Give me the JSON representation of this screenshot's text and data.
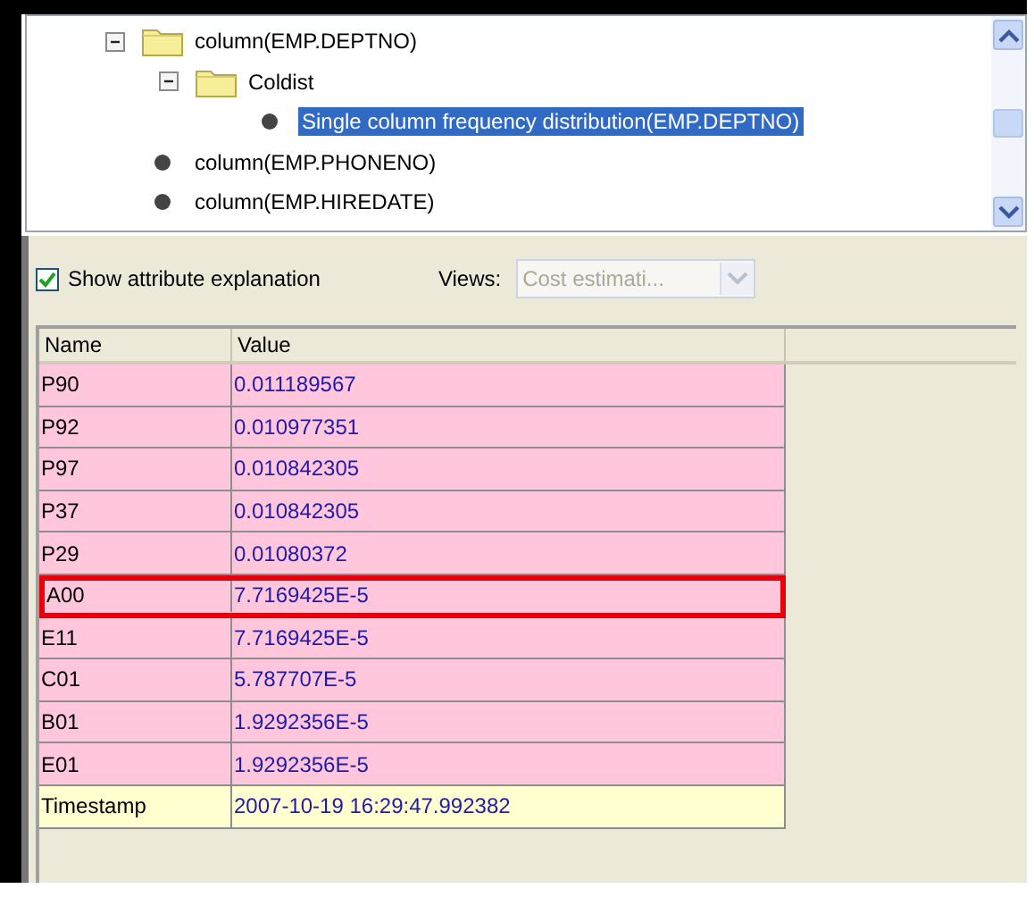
{
  "tree": [
    {
      "label": "column(EMP.DEPTNO)",
      "kind": "folder",
      "expanded": true,
      "selected": false,
      "children": [
        {
          "label": "Coldist",
          "kind": "folder",
          "expanded": true,
          "selected": false,
          "children": [
            {
              "label": "Single column frequency distribution(EMP.DEPTNO)",
              "kind": "leaf",
              "selected": true
            }
          ]
        }
      ]
    },
    {
      "label": "column(EMP.PHONENO)",
      "kind": "leaf",
      "selected": false
    },
    {
      "label": "column(EMP.HIREDATE)",
      "kind": "leaf",
      "selected": false
    }
  ],
  "options": {
    "checkbox": {
      "label": "Show attribute explanation",
      "checked": true
    },
    "views": {
      "label": "Views:",
      "value": "Cost estimati...",
      "disabled": true
    }
  },
  "table": {
    "columns": [
      "Name",
      "Value"
    ],
    "rows": [
      {
        "name": "P90",
        "value": "0.011189567",
        "kind": "attribute",
        "highlighted": false
      },
      {
        "name": "P92",
        "value": "0.010977351",
        "kind": "attribute",
        "highlighted": false
      },
      {
        "name": "P97",
        "value": "0.010842305",
        "kind": "attribute",
        "highlighted": false
      },
      {
        "name": "P37",
        "value": "0.010842305",
        "kind": "attribute",
        "highlighted": false
      },
      {
        "name": "P29",
        "value": "0.01080372",
        "kind": "attribute",
        "highlighted": false
      },
      {
        "name": "A00",
        "value": "7.7169425E-5",
        "kind": "attribute",
        "highlighted": true
      },
      {
        "name": "E11",
        "value": "7.7169425E-5",
        "kind": "attribute",
        "highlighted": false
      },
      {
        "name": "C01",
        "value": "5.787707E-5",
        "kind": "attribute",
        "highlighted": false
      },
      {
        "name": "B01",
        "value": "1.9292356E-5",
        "kind": "attribute",
        "highlighted": false
      },
      {
        "name": "E01",
        "value": "1.9292356E-5",
        "kind": "attribute",
        "highlighted": false
      },
      {
        "name": "Timestamp",
        "value": "2007-10-19 16:29:47.992382",
        "kind": "timestamp",
        "highlighted": false
      }
    ]
  }
}
